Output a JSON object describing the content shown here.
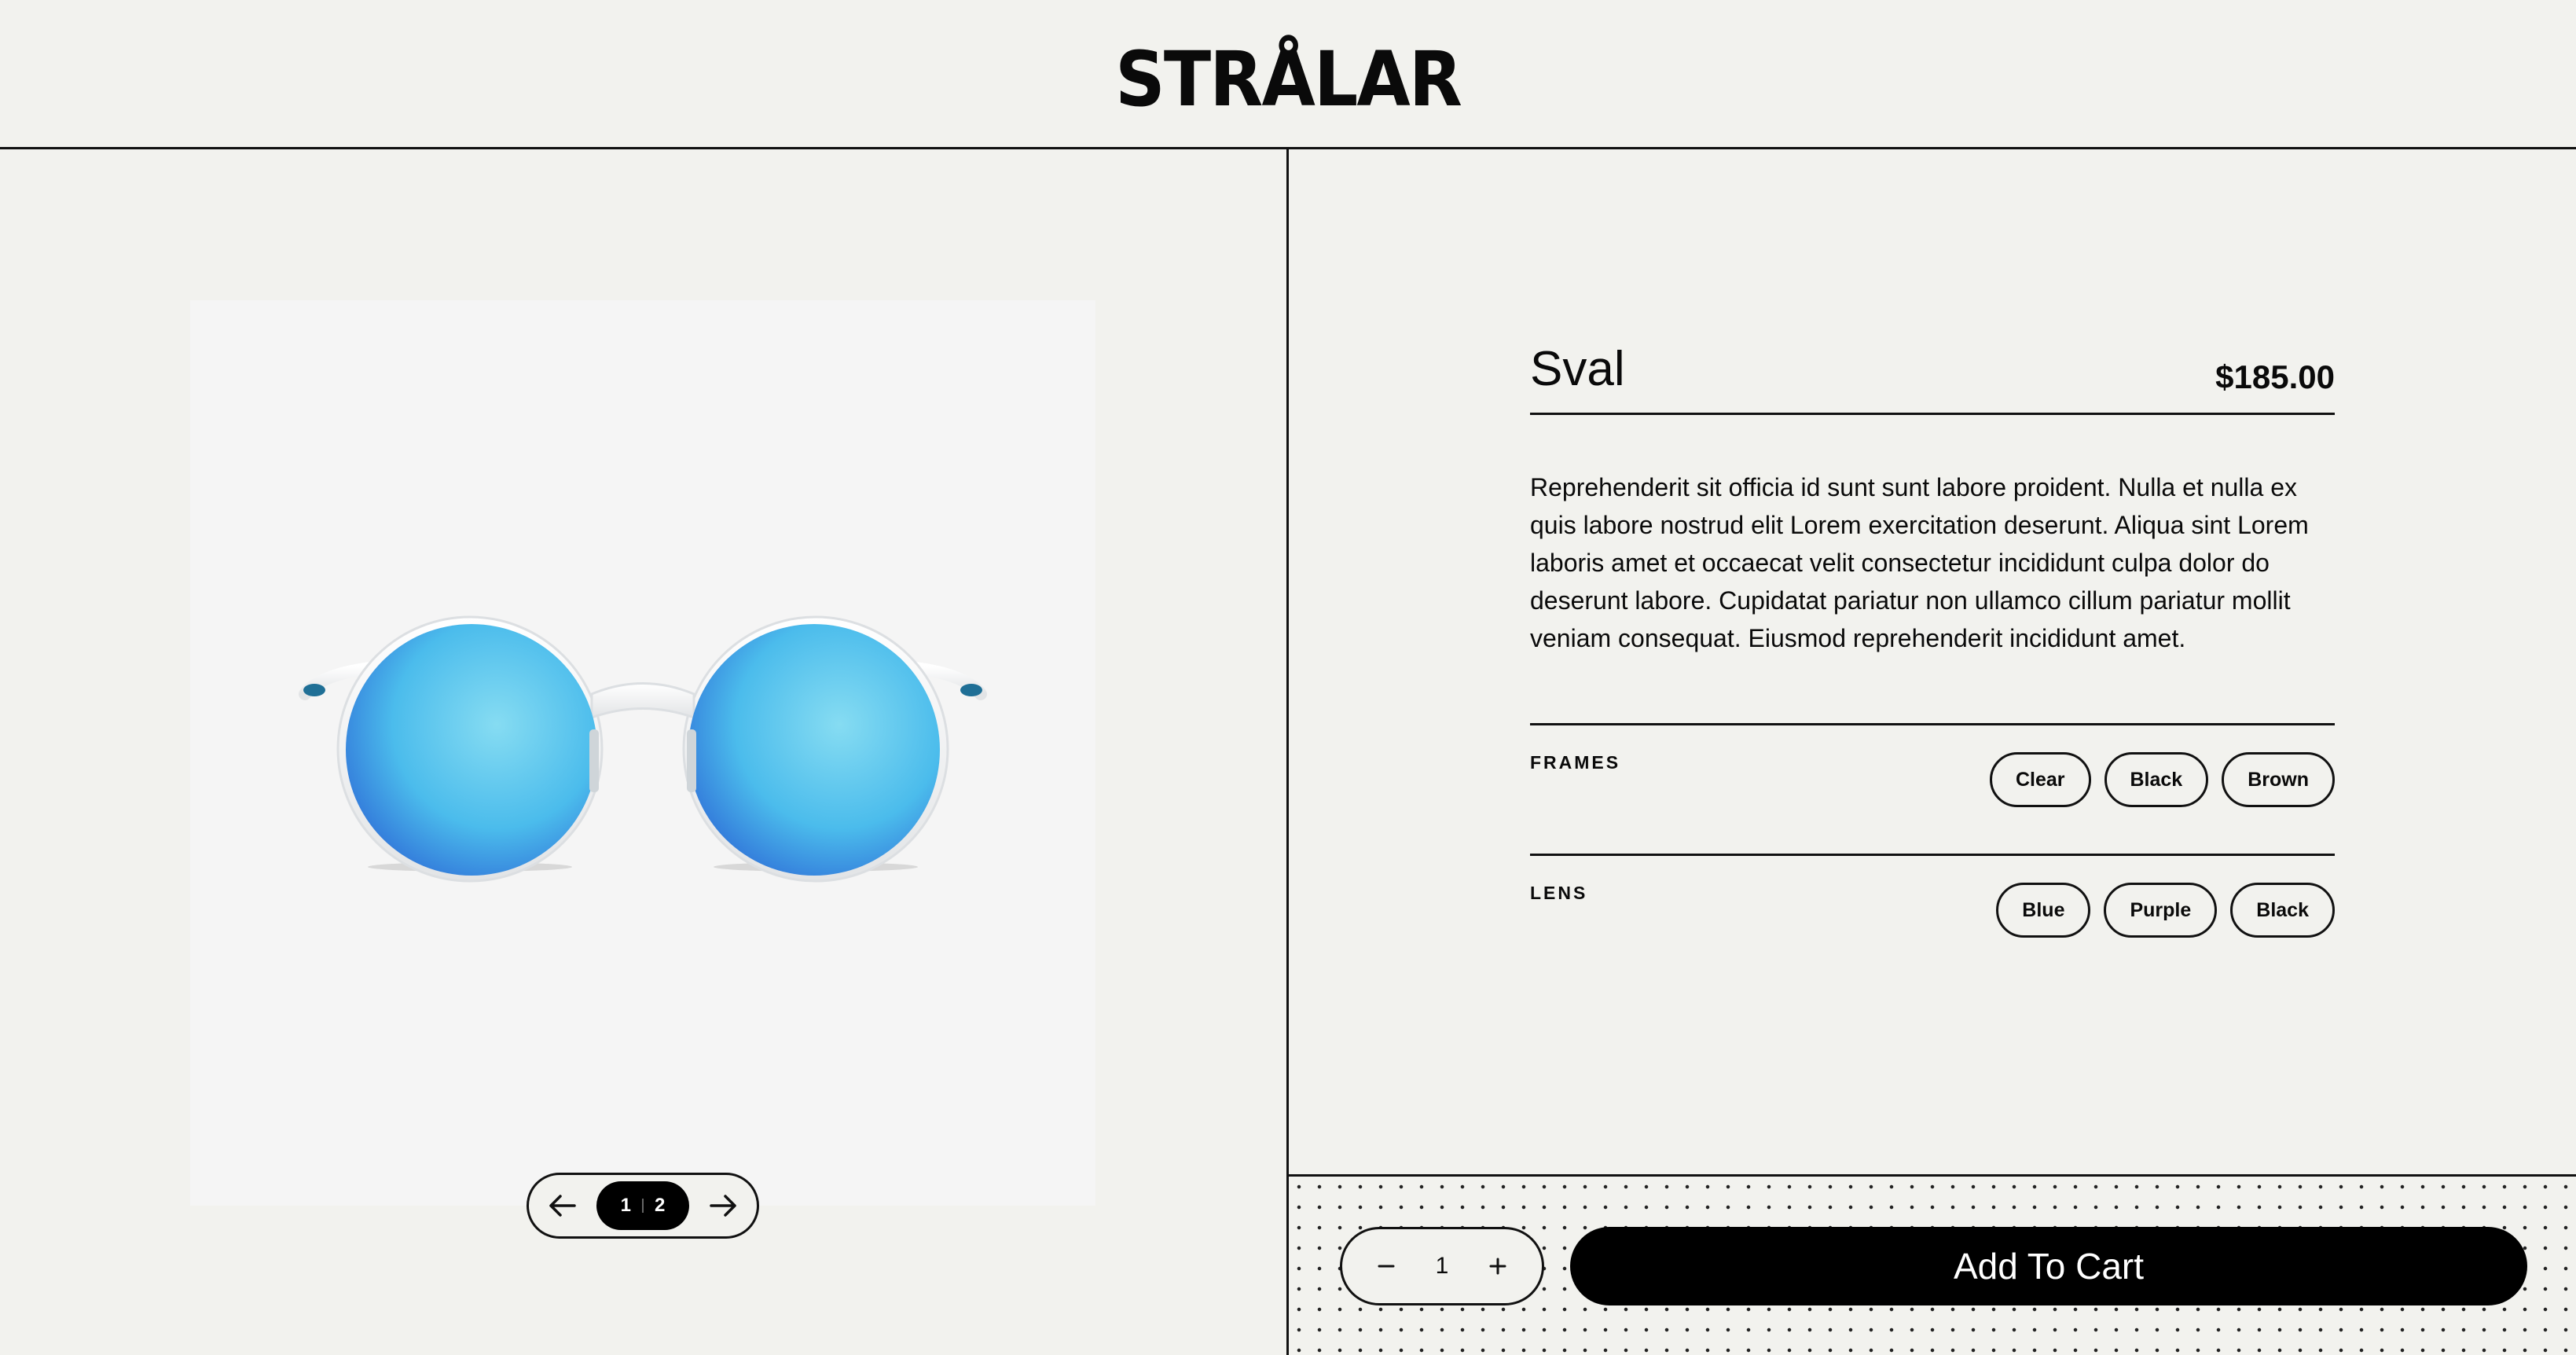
{
  "header": {
    "logo": "STRÅLAR"
  },
  "gallery": {
    "image_alt_icon": "sunglasses-product-image",
    "pager": {
      "current": "1",
      "total": "2",
      "prev_icon": "arrow-left-icon",
      "next_icon": "arrow-right-icon"
    }
  },
  "product": {
    "name": "Sval",
    "price": "$185.00",
    "description": "Reprehenderit sit officia id sunt sunt labore proident. Nulla et nulla ex quis labore nostrud elit Lorem exercitation deserunt. Aliqua sint Lorem laboris amet et occaecat velit consectetur incididunt culpa dolor do deserunt labore. Cupidatat pariatur non ullamco cillum pariatur mollit veniam consequat. Eiusmod reprehenderit incididunt amet.",
    "options": [
      {
        "label": "FRAMES",
        "values": [
          "Clear",
          "Black",
          "Brown"
        ]
      },
      {
        "label": "LENS",
        "values": [
          "Blue",
          "Purple",
          "Black"
        ]
      }
    ]
  },
  "cart": {
    "quantity": "1",
    "minus_icon": "minus-icon",
    "plus_icon": "plus-icon",
    "add_label": "Add To Cart"
  },
  "colors": {
    "background": "#f2f2ee",
    "lens_blue": "#4fc3f0",
    "accent": "#000000"
  }
}
